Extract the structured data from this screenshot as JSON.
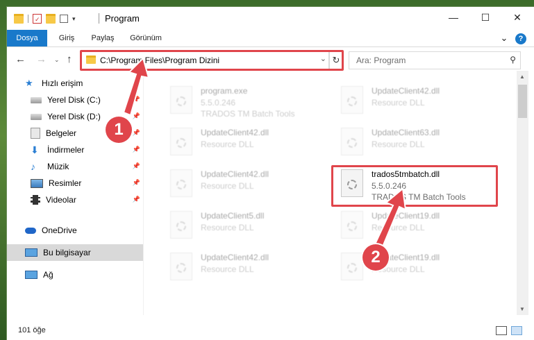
{
  "window": {
    "title": "Program",
    "minimize": "—",
    "maximize": "☐",
    "close": "✕"
  },
  "ribbon": {
    "tabs": [
      {
        "label": "Dosya",
        "active": true
      },
      {
        "label": "Giriş"
      },
      {
        "label": "Paylaş"
      },
      {
        "label": "Görünüm"
      }
    ],
    "expand": "⌄",
    "help": "?"
  },
  "address": {
    "path": "C:\\Program Files\\Program Dizini",
    "search_placeholder": "Ara: Program"
  },
  "sidebar": {
    "items": [
      {
        "label": "Hızlı erişim",
        "icon": "star-icon"
      },
      {
        "label": "Yerel Disk (C:)",
        "icon": "drive-icon",
        "pinned": true
      },
      {
        "label": "Yerel Disk (D:)",
        "icon": "drive-icon",
        "pinned": true
      },
      {
        "label": "Belgeler",
        "icon": "documents-icon",
        "pinned": true
      },
      {
        "label": "İndirmeler",
        "icon": "download-icon",
        "pinned": true
      },
      {
        "label": "Müzik",
        "icon": "music-icon",
        "pinned": true
      },
      {
        "label": "Resimler",
        "icon": "pictures-icon",
        "pinned": true
      },
      {
        "label": "Videolar",
        "icon": "video-icon",
        "pinned": true
      },
      {
        "label": "OneDrive",
        "icon": "cloud-icon"
      },
      {
        "label": "Bu bilgisayar",
        "icon": "computer-icon",
        "selected": true
      },
      {
        "label": "Ağ",
        "icon": "network-icon"
      }
    ]
  },
  "files": [
    {
      "name": "program.exe",
      "version": "5.5.0.246",
      "desc": "TRADOS TM Batch Tools",
      "faded": true
    },
    {
      "name": "UpdateClient42.dll",
      "version": "Resource DLL",
      "desc": "",
      "faded": true
    },
    {
      "name": "UpdateClient42.dll",
      "version": "Resource DLL",
      "desc": "",
      "faded": true
    },
    {
      "name": "UpdateClient63.dll",
      "version": "Resource DLL",
      "desc": "",
      "faded": true
    },
    {
      "name": "UpdateClient42.dll",
      "version": "Resource DLL",
      "desc": "",
      "faded": true
    },
    {
      "name": "trados5tmbatch.dll",
      "version": "5.5.0.246",
      "desc": "TRADOS TM Batch Tools",
      "faded": false
    },
    {
      "name": "UpdateClient5.dll",
      "version": "Resource DLL",
      "desc": "",
      "faded": true
    },
    {
      "name": "UpdateClient19.dll",
      "version": "Resource DLL",
      "desc": "",
      "faded": true
    },
    {
      "name": "UpdateClient42.dll",
      "version": "Resource DLL",
      "desc": "",
      "faded": true
    },
    {
      "name": "UpdateClient19.dll",
      "version": "Resource DLL",
      "desc": "",
      "faded": true
    }
  ],
  "status": {
    "count": "101 öğe"
  },
  "annotations": {
    "step1": "1",
    "step2": "2"
  },
  "colors": {
    "accent": "#1979ca",
    "highlight": "#e0454b"
  }
}
